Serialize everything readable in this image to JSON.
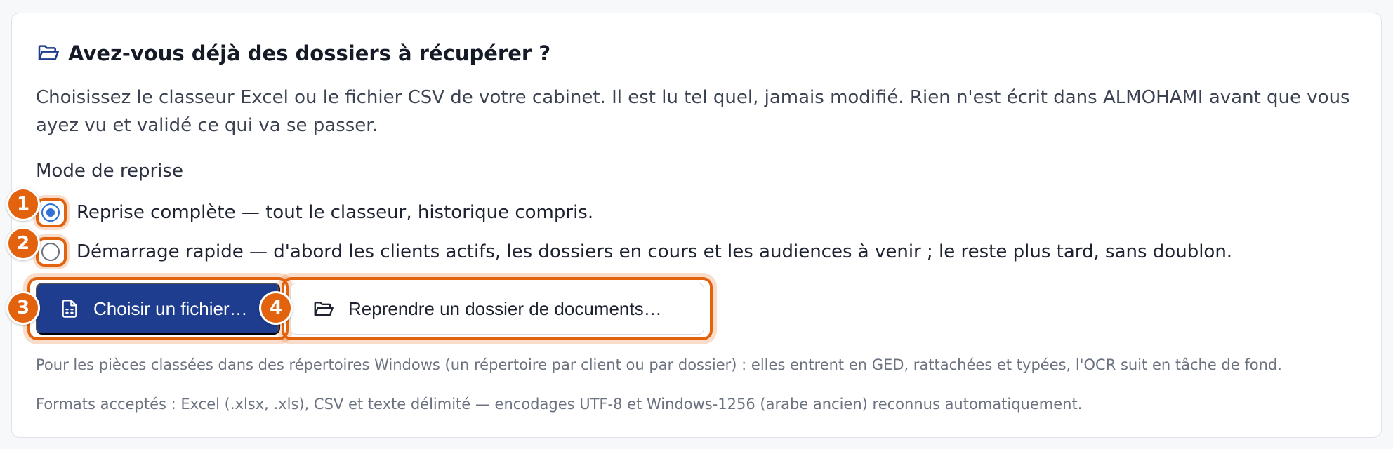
{
  "section": {
    "title": "Avez-vous déjà des dossiers à récupérer ?",
    "title_icon": "folder-open-icon",
    "description": "Choisissez le classeur Excel ou le fichier CSV de votre cabinet. Il est lu tel quel, jamais modifié. Rien n'est écrit dans ALMOHAMI avant que vous ayez vu et validé ce qui va se passer."
  },
  "mode": {
    "label": "Mode de reprise",
    "options": [
      {
        "label": "Reprise complète — tout le classeur, historique compris.",
        "selected": true
      },
      {
        "label": "Démarrage rapide — d'abord les clients actifs, les dossiers en cours et les audiences à venir ; le reste plus tard, sans doublon.",
        "selected": false
      }
    ]
  },
  "buttons": {
    "choose_file": {
      "label": "Choisir un fichier…",
      "icon": "file-spreadsheet-icon"
    },
    "resume_folder": {
      "label": "Reprendre un dossier de documents…",
      "icon": "folder-open-icon"
    }
  },
  "help": {
    "documents": "Pour les pièces classées dans des répertoires Windows (un répertoire par client ou par dossier) : elles entrent en GED, rattachées et typées, l'OCR suit en tâche de fond.",
    "formats": "Formats acceptés : Excel (.xlsx, .xls), CSV et texte délimité — encodages UTF-8 et Windows-1256 (arabe ancien) reconnus automatiquement."
  },
  "markers": [
    "1",
    "2",
    "3",
    "4"
  ],
  "colors": {
    "primary": "#1e3d8f",
    "highlight": "#e2620e",
    "radio_checked": "#2f6fd6"
  }
}
